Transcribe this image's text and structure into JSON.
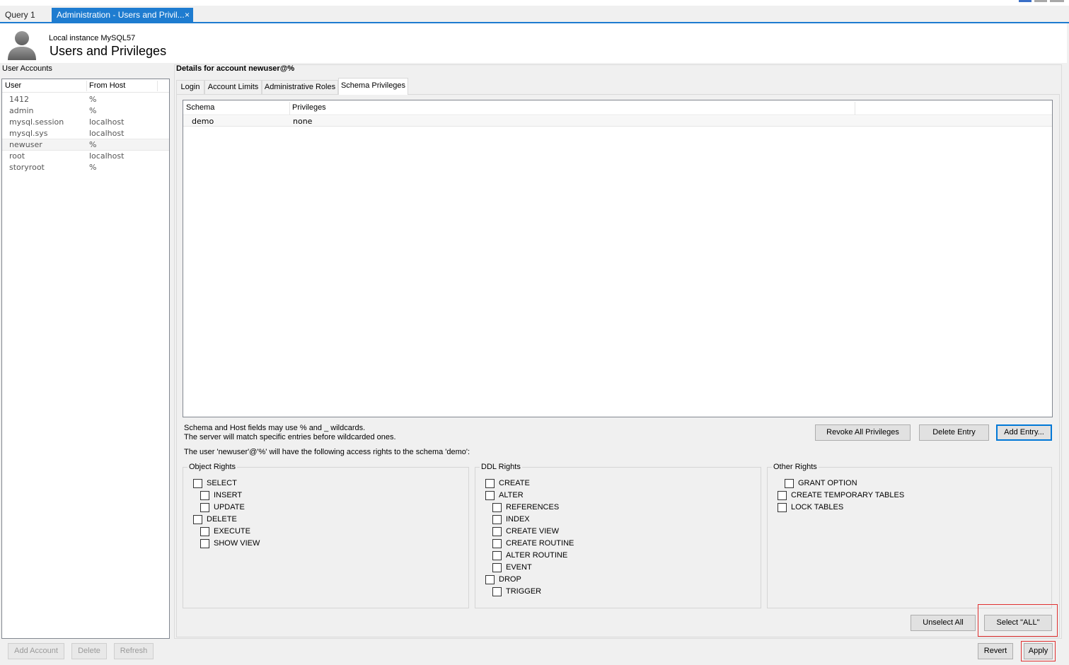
{
  "tabs": {
    "query": "Query 1",
    "admin": "Administration - Users and Privil...",
    "close_glyph": "×"
  },
  "header": {
    "instance": "Local instance MySQL57",
    "title": "Users and Privileges"
  },
  "accounts": {
    "label": "User Accounts",
    "col_user": "User",
    "col_host": "From Host",
    "rows": [
      {
        "user": "1412",
        "host": "%"
      },
      {
        "user": "admin",
        "host": "%"
      },
      {
        "user": "mysql.session",
        "host": "localhost"
      },
      {
        "user": "mysql.sys",
        "host": "localhost"
      },
      {
        "user": "newuser",
        "host": "%"
      },
      {
        "user": "root",
        "host": "localhost"
      },
      {
        "user": "storyroot",
        "host": "%"
      }
    ],
    "add_label": "Add Account",
    "delete_label": "Delete",
    "refresh_label": "Refresh"
  },
  "details": {
    "title": "Details for account newuser@%",
    "subtabs": [
      "Login",
      "Account Limits",
      "Administrative Roles",
      "Schema Privileges"
    ],
    "table": {
      "col_schema": "Schema",
      "col_priv": "Privileges",
      "rows": [
        {
          "schema": "demo",
          "priv": "none"
        }
      ]
    },
    "note1": "Schema and Host fields may use % and _ wildcards.",
    "note2": "The server will match specific entries before wildcarded ones.",
    "note3": "The user 'newuser'@'%' will have the following access rights to the schema 'demo':",
    "revoke_label": "Revoke All Privileges",
    "delete_entry_label": "Delete Entry",
    "add_entry_label": "Add Entry...",
    "object_rights": {
      "title": "Object Rights",
      "items": [
        "SELECT",
        "INSERT",
        "UPDATE",
        "DELETE",
        "EXECUTE",
        "SHOW VIEW"
      ]
    },
    "ddl_rights": {
      "title": "DDL Rights",
      "items": [
        "CREATE",
        "ALTER",
        "REFERENCES",
        "INDEX",
        "CREATE VIEW",
        "CREATE ROUTINE",
        "ALTER ROUTINE",
        "EVENT",
        "DROP",
        "TRIGGER"
      ]
    },
    "other_rights": {
      "title": "Other Rights",
      "items": [
        "GRANT OPTION",
        "CREATE TEMPORARY TABLES",
        "LOCK TABLES"
      ]
    },
    "unselect_label": "Unselect All",
    "select_all_label": "Select \"ALL\""
  },
  "footer": {
    "revert_label": "Revert",
    "apply_label": "Apply"
  },
  "colors": {
    "accent": "#1e7cd0",
    "highlight": "#e03030"
  }
}
